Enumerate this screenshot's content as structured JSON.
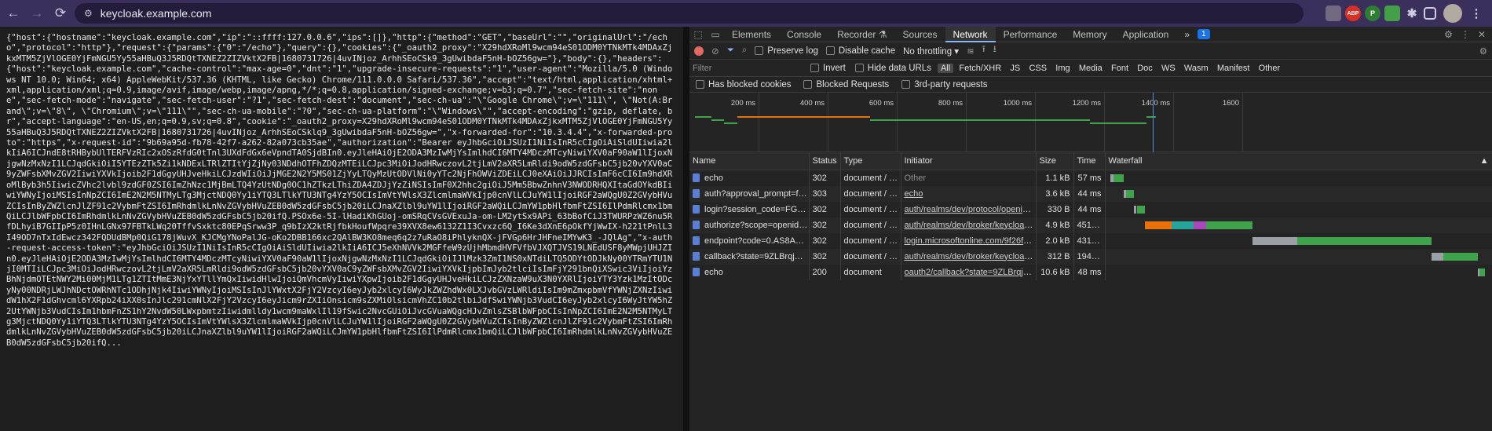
{
  "browser": {
    "url": "keycloak.example.com",
    "nav": {
      "back": "←",
      "forward": "→",
      "reload": "⟳"
    },
    "extensions": [
      "ABP",
      "P"
    ]
  },
  "page_text": "{\"host\":{\"hostname\":\"keycloak.example.com\",\"ip\":\"::ffff:127.0.0.6\",\"ips\":[]},\"http\":{\"method\":\"GET\",\"baseUrl\":\"\",\"originalUrl\":\"/echo\",\"protocol\":\"http\"},\"request\":{\"params\":{\"0\":\"/echo\"},\"query\":{},\"cookies\":{\"_oauth2_proxy\":\"X29hdXRoMl9wcm94eS01ODM0YTNkMTk4MDAxZjkxMTM5ZjVlOGE0YjFmNGU5Yy55aHBuQ3J5RDQtTXNEZ2ZIZVktX2FB|1680731726|4uvINjoz_ArhhSEoCSk9_3gUwibdaF5nH-bOZ56gw=\"},\"body\":{},\"headers\":{\"host\":\"keycloak.example.com\",\"cache-control\":\"max-age=0\",\"dnt\":\"1\",\"upgrade-insecure-requests\":\"1\",\"user-agent\":\"Mozilla/5.0 (Windows NT 10.0; Win64; x64) AppleWebKit/537.36 (KHTML, like Gecko) Chrome/111.0.0.0 Safari/537.36\",\"accept\":\"text/html,application/xhtml+xml,application/xml;q=0.9,image/avif,image/webp,image/apng,*/*;q=0.8,application/signed-exchange;v=b3;q=0.7\",\"sec-fetch-site\":\"none\",\"sec-fetch-mode\":\"navigate\",\"sec-fetch-user\":\"?1\",\"sec-fetch-dest\":\"document\",\"sec-ch-ua\":\"\\\"Google Chrome\\\";v=\\\"111\\\", \\\"Not(A:Brand\\\";v=\\\"8\\\", \\\"Chromium\\\";v=\\\"111\\\"\",\"sec-ch-ua-mobile\":\"?0\",\"sec-ch-ua-platform\":\"\\\"Windows\\\"\",\"accept-encoding\":\"gzip, deflate, br\",\"accept-language\":\"en-US,en;q=0.9,sv;q=0.8\",\"cookie\":\"_oauth2_proxy=X29hdXRoMl9wcm94eS01ODM0YTNkMTk4MDAxZjkxMTM5ZjVlOGE0YjFmNGU5Yy55aHBuQ3J5RDQtTXNEZ2ZIZVktX2FB|1680731726|4uvINjoz_ArhhSEoCSklq9_3gUwibdaF5nH-bOZ56gw=\",\"x-forwarded-for\":\"10.3.4.4\",\"x-forwarded-proto\":\"https\",\"x-request-id\":\"9b69a95d-fb78-42f7-a262-82a073cb35ae\",\"authorization\":\"Bearer eyJhbGciOiJSUzI1NiIsInR5cCIgOiAiSldUIiwia2lkIiA6ICJndE8tRHBybUlTERFVzRIc2xOSzRfdG0tTnl3UXdFdGx6eVpndTA0SjdBIn0.eyJleHAiOjE2ODA3MzIwMjYsImlhdCI6MTY4MDczMTcyNiwiYXV0aF90aW1lIjoxNjgwNzMxNzI1LCJqdGkiOiI5YTEzZTk5Zi1kNDExLTRlZTItYjZjNy03NDdhOTFhZDQzMTEiLCJpc3MiOiJodHRwczovL2tjLmV2aXR5LmRldi9odW5zdGFsbC5jb20vYXV0aC9yZWFsbXMvZGV2IiwiYXVkIjoib2F1dGgyUHJveHkiLCJzdWIiOiJjMGE2N2Y5MS01ZjYyLTQyMzUtODVlNi0yYTc2NjFhOWViZDEiLCJ0eXAiOiJJRCIsImF6cCI6Im9hdXRoMlByb3h5IiwicZVhc2lvbl9zdGF0ZSI6ImZhNzc1MjBmLTQ4YzUtNDg0OC1hZTkzLThiZDA4ZDJjYzZiNSIsImF0X2hhc2giOiJ5Mm5BbwZnhnV3NWODRHQXItaGdOYkdBIiwiYWNyIjoiMSIsInNpZCI6ImE2N2M5NTMyLTg3MjctNDQ0Yy1iYTQ3LTlkYTU3NTg4YzY5OCIsImVtYWlsX3ZlcmlmaWVkIjp0cnVlLCJuYW1lIjoiRGF2aWQgU0Z2GVybHVuZCIsInByZWZlcnJlZF91c2VybmFtZSI6ImRhdmlkLnNvZGVybHVuZEB0dW5zdGFsbC5jb20iLCJnaXZlbl9uYW1lIjoiRGF2aWQiLCJmYW1pbHlfbmFtZSI6IlPdmRlcmx1bmQiLCJlbWFpbCI6ImRhdmlkLnNvZGVybHVuZEB0dW5zdGFsbC5jb20ifQ.PSOx6e-5I-lHadiKhGUoj-omSRqCVsGVExuJa-om-LM2ytSx9APi_63bBofCiJ3TWURPzWZ6nu5RfDLhyiB7GIIpP5z0IHnLGNx97FBTkLWq20TffvSxktc80EPqSrww3P_q9bIzX2ktRjfbkHoufWpqre39XVX8ew6132Z1I3Cvxzc6Q_I6Ke3dXnE6pOkfYjWwIX-h221tPnlL3I49OD7nTxIdEwcz342FQDUdBMp0QiG178jWuvX_KJCMgYNoPalJG-oKo2DBB166xc2QAlBW3KO8meq6q2z7uRaO8iPhlyknQX-jFVGp6HrJHFneIMYwK3_-JQlAg\",\"x-auth-request-access-token\":\"eyJhbGciOiJSUzI1NiIsInR5cCIgOiAiSldUIiwia2lkIiA6ICJ5eXhNVVk2MGFfeW9zUjhMbmdHVFVfbVJXQTJVS19LNEdUSF8yMWpjUHJZIn0.eyJleHAiOjE2ODA3MzIwMjYsImlhdCI6MTY4MDczMTcyNiwiYXV0aF90aW1lIjoxNjgwNzMxNzI1LCJqdGkiOiIJlMzk3ZmI1NS0xNTdiLTQ5ODYtODJkNy00YTRmYTU1NjI0MTIiLCJpc3MiOiJodHRwczovL2tjLmV2aXR5LmRldi9odW5zdGFsbC5jb20vYXV0aC9yZWFsbXMvZGV2IiwiYXVkIjpbImJyb2tlciIsImFjY291bnQiXSwic3ViIjoiYzBhNjdmOTEtNWY2Mi00MjM1LTg1ZTItMmE3NjYxYTllYmQxIiwidHlwIjoiQmVhcmVyIiwiYXpwIjoib2F1dGgyUHJveHkiLCJzZXNzaW9uX3N0YXRlIjoiYTY3Yzk1MzItODcyNy00NDRjLWJhNDctOWRhNTc1ODhjNjk4IiwiYWNyIjoiMSIsInJlYWxtX2FjY2VzcyI6eyJyb2xlcyI6WyJkZWZhdWx0LXJvbGVzLWRldiIsIm9mZmxpbmVfYWNjZXNzIiwidW1hX2F1dGhvcml6YXRpb24iXX0sInJlc291cmNlX2FjY2VzcyI6eyJicm9rZXIiOnsicm9sZXMiOlsicmVhZC10b2tlbiJdfSwiYWNjb3VudCI6eyJyb2xlcyI6WyJtYW5hZ2UtYWNjb3VudCIsIm1hbmFnZS1hY2NvdW50LWxpbmtzIiwidmlldy1wcm9maWxlIl19fSwic2NvcGUiOiJvcGVuaWQgcHJvZmlsZSBlbWFpbCIsInNpZCI6ImE2N2M5NTMyLTg3MjctNDQ0Yy1iYTQ3LTlkYTU3NTg4YzY5OCIsImVtYWlsX3ZlcmlmaWVkIjp0cnVlLCJuYW1lIjoiRGF2aWQgU0Z2GVybHVuZCIsInByZWZlcnJlZF91c2VybmFtZSI6ImRhdmlkLnNvZGVybHVuZEB0dW5zdGFsbC5jb20iLCJnaXZlbl9uYW1lIjoiRGF2aWQiLCJmYW1pbHlfbmFtZSI6IlPdmRlcmx1bmQiLCJlbWFpbCI6ImRhdmlkLnNvZGVybHVuZEB0dW5zdGFsbC5jb20ifQ...",
  "devtools": {
    "tabs": [
      "Elements",
      "Console",
      "Recorder ⚗",
      "Sources",
      "Network",
      "Performance",
      "Memory",
      "Application"
    ],
    "active_tab": "Network",
    "more": "»",
    "issues_badge": "1",
    "toolbar": {
      "preserve_log": "Preserve log",
      "disable_cache": "Disable cache",
      "throttling": "No throttling"
    },
    "filter": {
      "placeholder": "Filter",
      "invert": "Invert",
      "hide_data_urls": "Hide data URLs",
      "types": [
        "All",
        "Fetch/XHR",
        "JS",
        "CSS",
        "Img",
        "Media",
        "Font",
        "Doc",
        "WS",
        "Wasm",
        "Manifest",
        "Other"
      ],
      "active_type": "All"
    },
    "blocked": {
      "has_blocked_cookies": "Has blocked cookies",
      "blocked_requests": "Blocked Requests",
      "third_party": "3rd-party requests"
    },
    "timeline_ticks": [
      "200 ms",
      "400 ms",
      "600 ms",
      "800 ms",
      "1000 ms",
      "1200 ms",
      "1400 ms",
      "1600"
    ],
    "columns": {
      "name": "Name",
      "status": "Status",
      "type": "Type",
      "initiator": "Initiator",
      "size": "Size",
      "time": "Time",
      "waterfall": "Waterfall"
    },
    "requests": [
      {
        "name": "echo",
        "status": "302",
        "type": "document / R...",
        "initiator": "Other",
        "initiator_link": false,
        "size": "1.1 kB",
        "time": "57 ms",
        "wf_start": 0.005,
        "wf_end": 0.04
      },
      {
        "name": "auth?approval_prompt=for...",
        "status": "303",
        "type": "document / R...",
        "initiator": "echo",
        "initiator_link": true,
        "size": "3.6 kB",
        "time": "44 ms",
        "wf_start": 0.04,
        "wf_end": 0.068
      },
      {
        "name": "login?session_code=FG01K...",
        "status": "302",
        "type": "document / R...",
        "initiator": "auth/realms/dev/protocol/openid-c...",
        "initiator_link": true,
        "size": "330 B",
        "time": "44 ms",
        "wf_start": 0.068,
        "wf_end": 0.096
      },
      {
        "name": "authorize?scope=openid+...",
        "status": "302",
        "type": "document / R...",
        "initiator": "auth/realms/dev/broker/keycloak-t...",
        "initiator_link": true,
        "size": "4.9 kB",
        "time": "451 ms",
        "wf_start": 0.096,
        "wf_end": 0.383
      },
      {
        "name": "endpoint?code=0.AS8ADPI...",
        "status": "302",
        "type": "document / R...",
        "initiator": "login.microsoftonline.com/9f26f20c...",
        "initiator_link": true,
        "size": "2.0 kB",
        "time": "431 ms",
        "wf_start": 0.383,
        "wf_end": 0.857
      },
      {
        "name": "callback?state=9ZLBrqjKgW...",
        "status": "302",
        "type": "document / R...",
        "initiator": "auth/realms/dev/broker/keycloak-t...",
        "initiator_link": true,
        "size": "312 B",
        "time": "194 ms",
        "wf_start": 0.857,
        "wf_end": 0.98
      },
      {
        "name": "echo",
        "status": "200",
        "type": "document",
        "initiator": "oauth2/callback?state=9ZLBrqjKgW...",
        "initiator_link": true,
        "size": "10.6 kB",
        "time": "48 ms",
        "wf_start": 0.98,
        "wf_end": 1.0
      }
    ]
  }
}
